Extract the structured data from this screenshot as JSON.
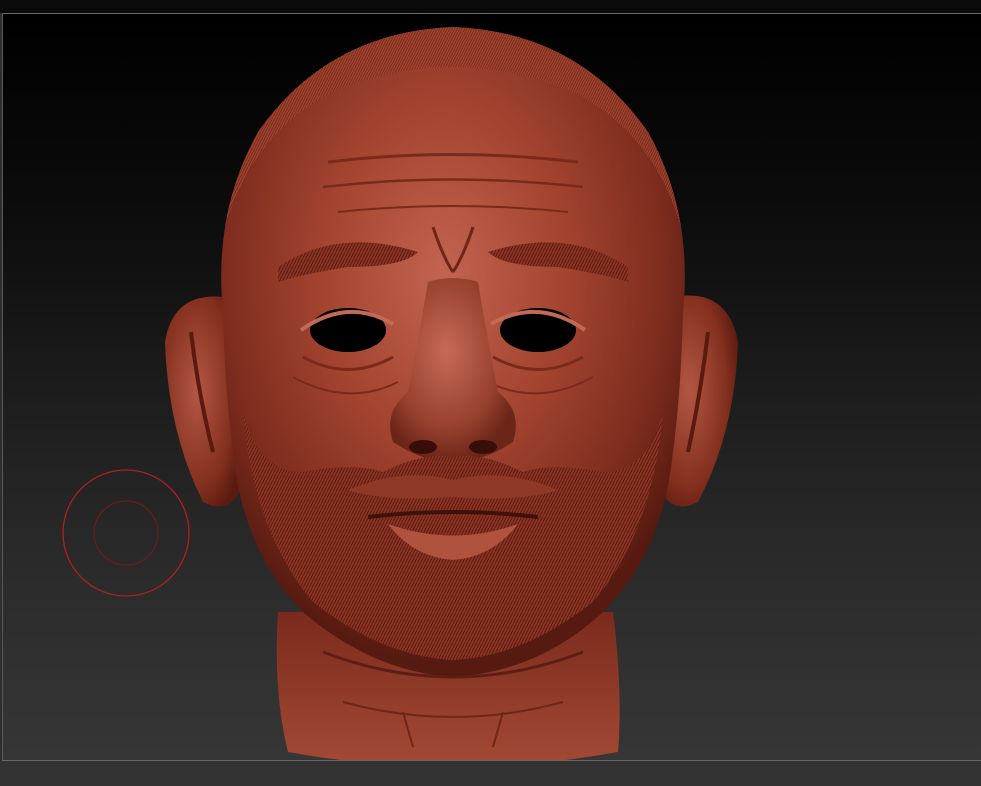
{
  "canvas": {
    "background_top": "#000000",
    "background_bottom": "#363636"
  },
  "model": {
    "label": "sculpted-head-model",
    "clay_color": "#9a3b2c",
    "shadow_color": "#5e1e14",
    "highlight_color": "#c66a55"
  },
  "brush": {
    "outer_ring_color": "#b02020",
    "inner_ring_color": "#7a1a1a"
  }
}
